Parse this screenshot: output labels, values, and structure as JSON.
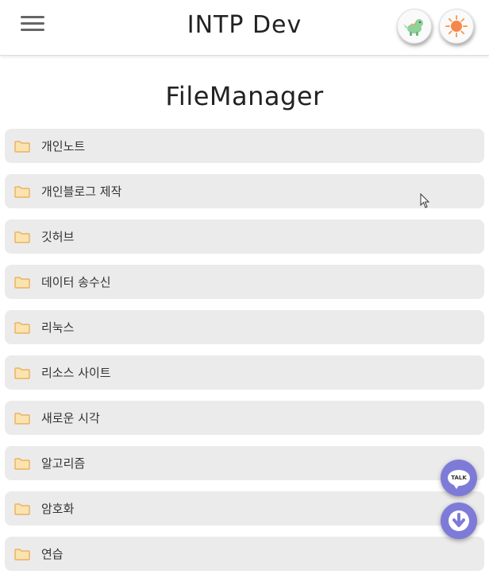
{
  "header": {
    "title": "INTP Dev",
    "menu_icon": "hamburger-menu-icon",
    "lang_icon": "dinosaur-icon",
    "theme_icon": "sun-icon"
  },
  "page": {
    "title": "FileManager"
  },
  "folders": [
    {
      "label": "개인노트"
    },
    {
      "label": "개인블로그 제작"
    },
    {
      "label": "깃허브"
    },
    {
      "label": "데이터 송수신"
    },
    {
      "label": "리눅스"
    },
    {
      "label": "리소스 사이트"
    },
    {
      "label": "새로운 시각"
    },
    {
      "label": "알고리즘"
    },
    {
      "label": "암호화"
    },
    {
      "label": "연습"
    }
  ],
  "fabs": {
    "talk_label": "TALK",
    "talk_icon": "chat-talk-icon",
    "down_icon": "arrow-down-icon"
  },
  "colors": {
    "item_bg": "#ebebeb",
    "fab_bg": "#7e7bd8",
    "folder_icon": "#f5c26b"
  }
}
